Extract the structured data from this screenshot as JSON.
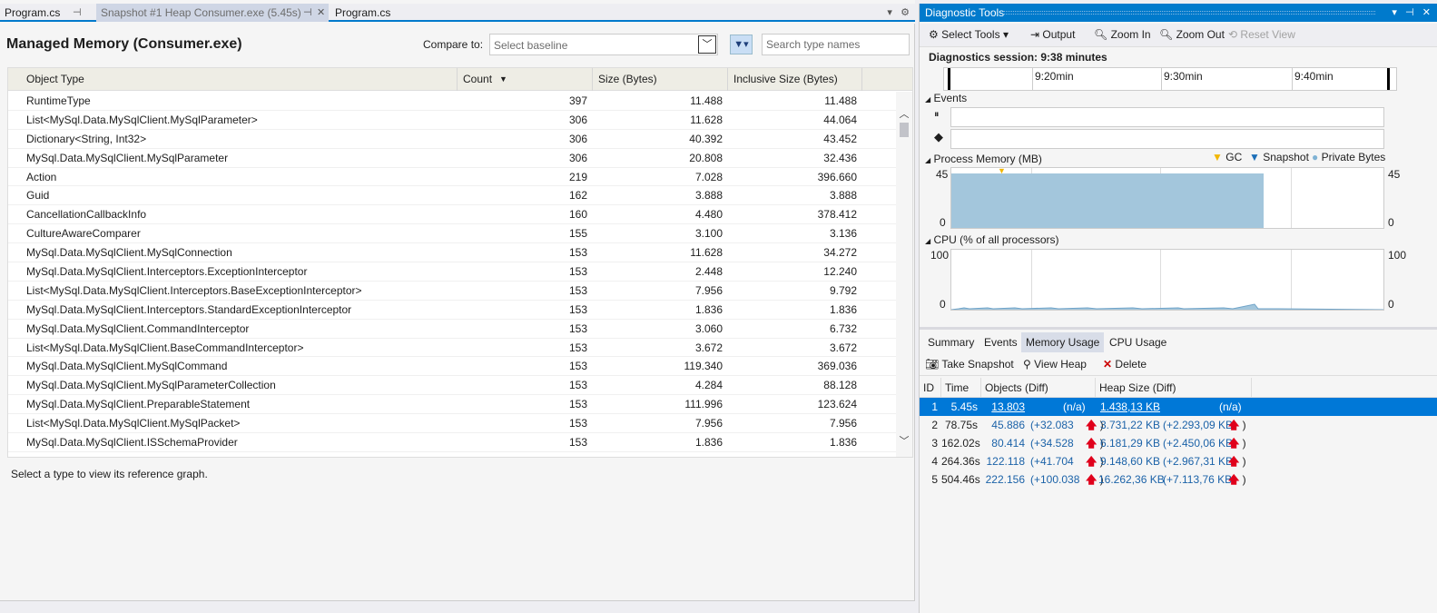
{
  "tabs": [
    {
      "label": "Program.cs",
      "icon": "pin-icon"
    },
    {
      "label": "Snapshot #1 Heap Consumer.exe (5.45s)",
      "icon": "pin-icon"
    },
    {
      "label": "Program.cs"
    }
  ],
  "header": {
    "title": "Managed Memory (Consumer.exe)",
    "compare_label": "Compare to:",
    "baseline_placeholder": "Select baseline",
    "search_placeholder": "Search type names"
  },
  "grid": {
    "columns": [
      "Object Type",
      "Count",
      "Size (Bytes)",
      "Inclusive Size (Bytes)"
    ],
    "rows": [
      {
        "type": "RuntimeType",
        "count": "397",
        "size": "11.488",
        "incl": "11.488"
      },
      {
        "type": "List<MySql.Data.MySqlClient.MySqlParameter>",
        "count": "306",
        "size": "11.628",
        "incl": "44.064"
      },
      {
        "type": "Dictionary<String, Int32>",
        "count": "306",
        "size": "40.392",
        "incl": "43.452"
      },
      {
        "type": "MySql.Data.MySqlClient.MySqlParameter",
        "count": "306",
        "size": "20.808",
        "incl": "32.436"
      },
      {
        "type": "Action",
        "count": "219",
        "size": "7.028",
        "incl": "396.660"
      },
      {
        "type": "Guid",
        "count": "162",
        "size": "3.888",
        "incl": "3.888"
      },
      {
        "type": "CancellationCallbackInfo",
        "count": "160",
        "size": "4.480",
        "incl": "378.412"
      },
      {
        "type": "CultureAwareComparer",
        "count": "155",
        "size": "3.100",
        "incl": "3.136"
      },
      {
        "type": "MySql.Data.MySqlClient.MySqlConnection",
        "count": "153",
        "size": "11.628",
        "incl": "34.272"
      },
      {
        "type": "MySql.Data.MySqlClient.Interceptors.ExceptionInterceptor",
        "count": "153",
        "size": "2.448",
        "incl": "12.240"
      },
      {
        "type": "List<MySql.Data.MySqlClient.Interceptors.BaseExceptionInterceptor>",
        "count": "153",
        "size": "7.956",
        "incl": "9.792"
      },
      {
        "type": "MySql.Data.MySqlClient.Interceptors.StandardExceptionInterceptor",
        "count": "153",
        "size": "1.836",
        "incl": "1.836"
      },
      {
        "type": "MySql.Data.MySqlClient.CommandInterceptor",
        "count": "153",
        "size": "3.060",
        "incl": "6.732"
      },
      {
        "type": "List<MySql.Data.MySqlClient.BaseCommandInterceptor>",
        "count": "153",
        "size": "3.672",
        "incl": "3.672"
      },
      {
        "type": "MySql.Data.MySqlClient.MySqlCommand",
        "count": "153",
        "size": "119.340",
        "incl": "369.036"
      },
      {
        "type": "MySql.Data.MySqlClient.MySqlParameterCollection",
        "count": "153",
        "size": "4.284",
        "incl": "88.128"
      },
      {
        "type": "MySql.Data.MySqlClient.PreparableStatement",
        "count": "153",
        "size": "111.996",
        "incl": "123.624"
      },
      {
        "type": "List<MySql.Data.MySqlClient.MySqlPacket>",
        "count": "153",
        "size": "7.956",
        "incl": "7.956"
      },
      {
        "type": "MySql.Data.MySqlClient.ISSchemaProvider",
        "count": "153",
        "size": "1.836",
        "incl": "1.836"
      }
    ]
  },
  "status_text": "Select a type to view its reference graph.",
  "diag": {
    "title": "Diagnostic Tools",
    "toolbar": {
      "select_tools": "Select Tools",
      "output": "Output",
      "zoom_in": "Zoom In",
      "zoom_out": "Zoom Out",
      "reset_view": "Reset View"
    },
    "session": "Diagnostics session: 9:38 minutes",
    "timeline_ticks": [
      "9:20min",
      "9:30min",
      "9:40min"
    ],
    "events_title": "Events",
    "memory_title": "Process Memory (MB)",
    "memory_legend": {
      "gc": "GC",
      "snapshot": "Snapshot",
      "private": "Private Bytes"
    },
    "memory_axis": {
      "max": "45",
      "min": "0"
    },
    "cpu_title": "CPU (% of all processors)",
    "cpu_axis": {
      "max": "100",
      "min": "0"
    },
    "tabs": [
      "Summary",
      "Events",
      "Memory Usage",
      "CPU Usage"
    ],
    "actions": {
      "take_snapshot": "Take Snapshot",
      "view_heap": "View Heap",
      "delete": "Delete"
    },
    "snap_columns": [
      "ID",
      "Time",
      "Objects (Diff)",
      "Heap Size (Diff)"
    ],
    "snapshots": [
      {
        "id": "1",
        "time": "5.45s",
        "objects": "13.803",
        "obj_diff": "(n/a)",
        "heap": "1.438,13 KB",
        "heap_diff": "(n/a)"
      },
      {
        "id": "2",
        "time": "78.75s",
        "objects": "45.886",
        "obj_diff": "(+32.083",
        "heap": "3.731,22 KB",
        "heap_diff": "(+2.293,09 KB"
      },
      {
        "id": "3",
        "time": "162.02s",
        "objects": "80.414",
        "obj_diff": "(+34.528",
        "heap": "6.181,29 KB",
        "heap_diff": "(+2.450,06 KB"
      },
      {
        "id": "4",
        "time": "264.36s",
        "objects": "122.118",
        "obj_diff": "(+41.704",
        "heap": "9.148,60 KB",
        "heap_diff": "(+2.967,31 KB"
      },
      {
        "id": "5",
        "time": "504.46s",
        "objects": "222.156",
        "obj_diff": "(+100.038",
        "heap": "16.262,36 KB",
        "heap_diff": "(+7.113,76 KB"
      }
    ],
    "colors": {
      "accent": "#007acc",
      "memory_fill": "#a3c6dc",
      "gc_marker": "#f2b705",
      "snapshot_marker": "#1c6fb8",
      "private_bytes": "#7fb2d4",
      "up_arrow": "#e0001b"
    }
  }
}
